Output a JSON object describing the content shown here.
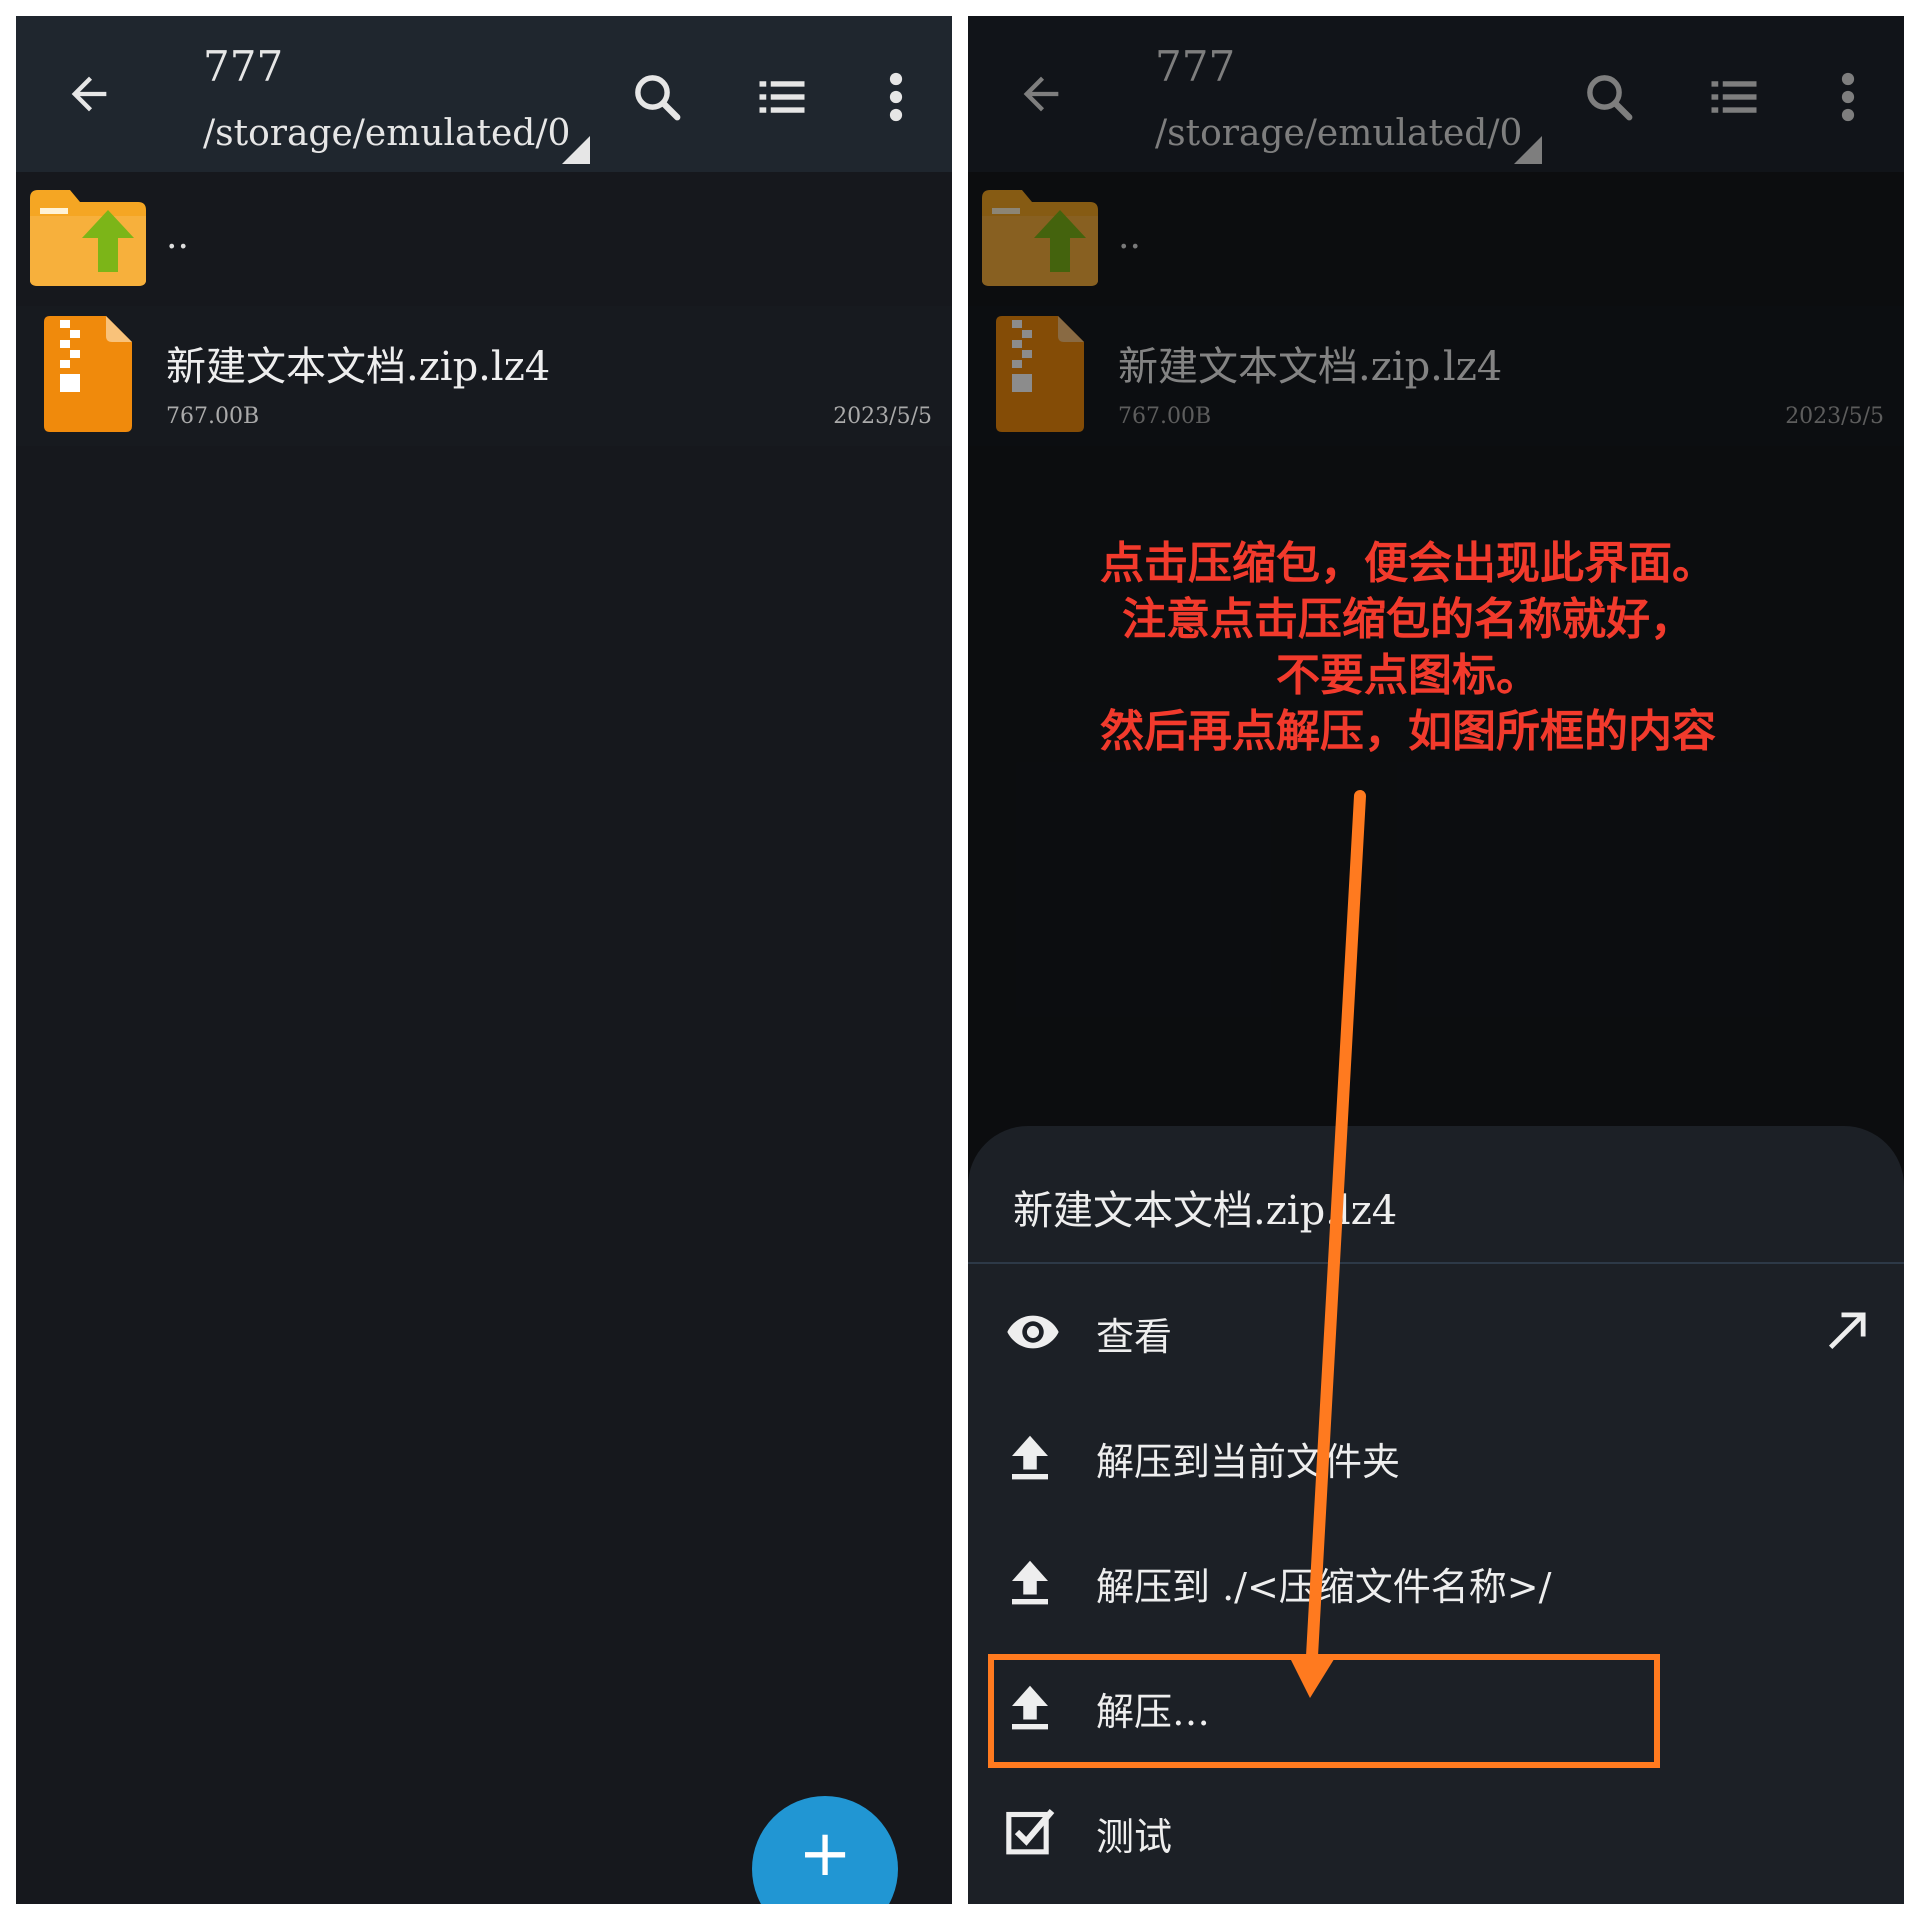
{
  "left_panel": {
    "header": {
      "title": "777",
      "path": "/storage/emulated/0"
    },
    "up_row": {
      "label": ".."
    },
    "file": {
      "name": "新建文本文档.zip.lz4",
      "size": "767.00B",
      "date": "2023/5/5"
    },
    "fab": {
      "label": "+"
    }
  },
  "right_panel": {
    "header": {
      "title": "777",
      "path": "/storage/emulated/0"
    },
    "up_row": {
      "label": ".."
    },
    "file": {
      "name": "新建文本文档.zip.lz4",
      "size": "767.00B",
      "date": "2023/5/5"
    },
    "annotation": {
      "lines": [
        "点击压缩包，便会出现此界面。",
        "注意点击压缩包的名称就好，",
        "不要点图标。",
        "然后再点解压，如图所框的内容"
      ]
    },
    "sheet": {
      "title": "新建文本文档.zip.lz4",
      "items": [
        {
          "label": "查看",
          "icon": "eye-icon"
        },
        {
          "label": "解压到当前文件夹",
          "icon": "upload-icon"
        },
        {
          "label": "解压到 ./<压缩文件名称>/",
          "icon": "upload-icon"
        },
        {
          "label": "解压…",
          "icon": "upload-icon"
        },
        {
          "label": "测试",
          "icon": "checkbox-icon"
        }
      ]
    }
  },
  "colors": {
    "background": "#16181d",
    "toolbar": "#1f262e",
    "sheet": "#1c2026",
    "fab": "#2196d3",
    "annotation_text": "#f23a2c",
    "annotation_arrow": "#ff7a1f",
    "folder": "#f5a623",
    "up_arrow": "#7cb518"
  }
}
